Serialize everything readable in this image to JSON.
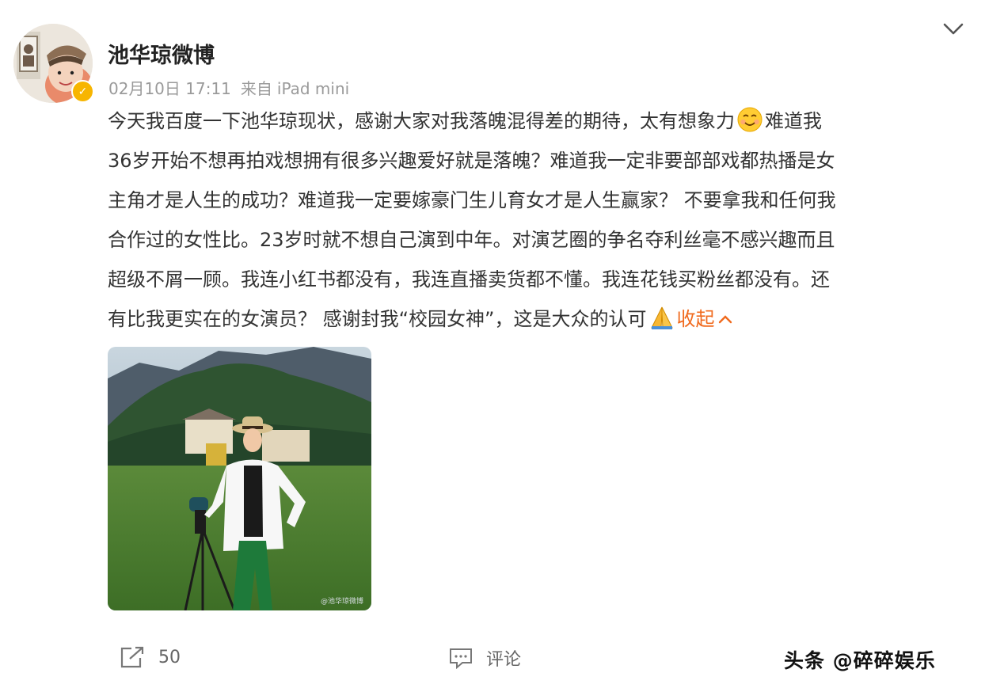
{
  "post": {
    "username": "池华琼微博",
    "date": "02月10日 17:11",
    "source_prefix": "来自",
    "source": "iPad mini",
    "text_lines": [
      [
        "今天我百度一下池华琼现状，感谢大家对我落魄混得差的期待，太有想象力",
        "难道我"
      ],
      [
        "36岁开始不想再拍戏想拥有很多兴趣爱好就是落魄？难道我一定非要部部戏都热播是女"
      ],
      [
        "主角才是人生的成功？难道我一定要嫁豪门生儿育女才是人生赢家？ 不要拿我和任何我"
      ],
      [
        "合作过的女性比。23岁时就不想自己演到中年。对演艺圈的争名夺利丝毫不感兴趣而且"
      ],
      [
        "超级不屑一顾。我连小红书都没有，我连直播卖货都不懂。我连花钱买粉丝都没有。还"
      ],
      [
        "有比我更实在的女演员？ 感谢封我“校园女神”，这是大众的认可"
      ]
    ],
    "collapse_label": "收起",
    "emoji_1": "smile-emoji",
    "emoji_2": "pray-emoji",
    "image_watermark": "@池华琼微博"
  },
  "actions": {
    "repost_count": "50",
    "comment_label": "评论"
  },
  "watermark": "头条 @碎碎娱乐",
  "colors": {
    "accent": "#f06a1e",
    "verified": "#f7b500",
    "meta": "#9a9a9a"
  }
}
